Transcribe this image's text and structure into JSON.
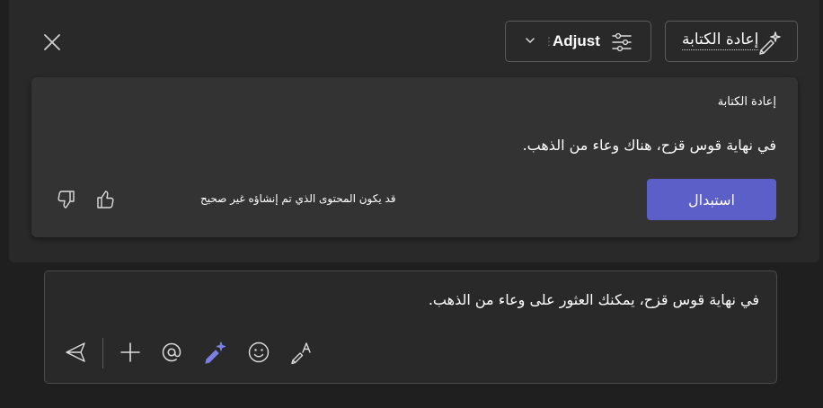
{
  "header": {
    "close_icon": "close-icon",
    "adjust": {
      "label": "Adjust",
      "icon": "sliders-icon",
      "chevron": "chevron-down-icon"
    },
    "rewrite": {
      "label": "إعادة الكتابة",
      "icon": "magic-pen-sparkle-icon"
    }
  },
  "suggestion": {
    "title": "إعادة الكتابة",
    "text": "في نهاية قوس قزح، هناك وعاء من الذهب.",
    "replace_label": "استبدال",
    "disclaimer": "قد يكون المحتوى الذي تم إنشاؤه غير صحيح",
    "feedback_icons": [
      "thumbs-up-icon",
      "thumbs-down-icon"
    ]
  },
  "composer": {
    "text": "في نهاية قوس قزح، يمكنك العثور على وعاء من الذهب.",
    "toolbar_icons": [
      "send-icon",
      "add-icon",
      "mention-icon",
      "copilot-rewrite-icon",
      "emoji-icon",
      "format-icon"
    ]
  },
  "colors": {
    "accent": "#5b5fc7",
    "background": "#1f1f1f",
    "panel": "#292929",
    "card": "#333333"
  }
}
